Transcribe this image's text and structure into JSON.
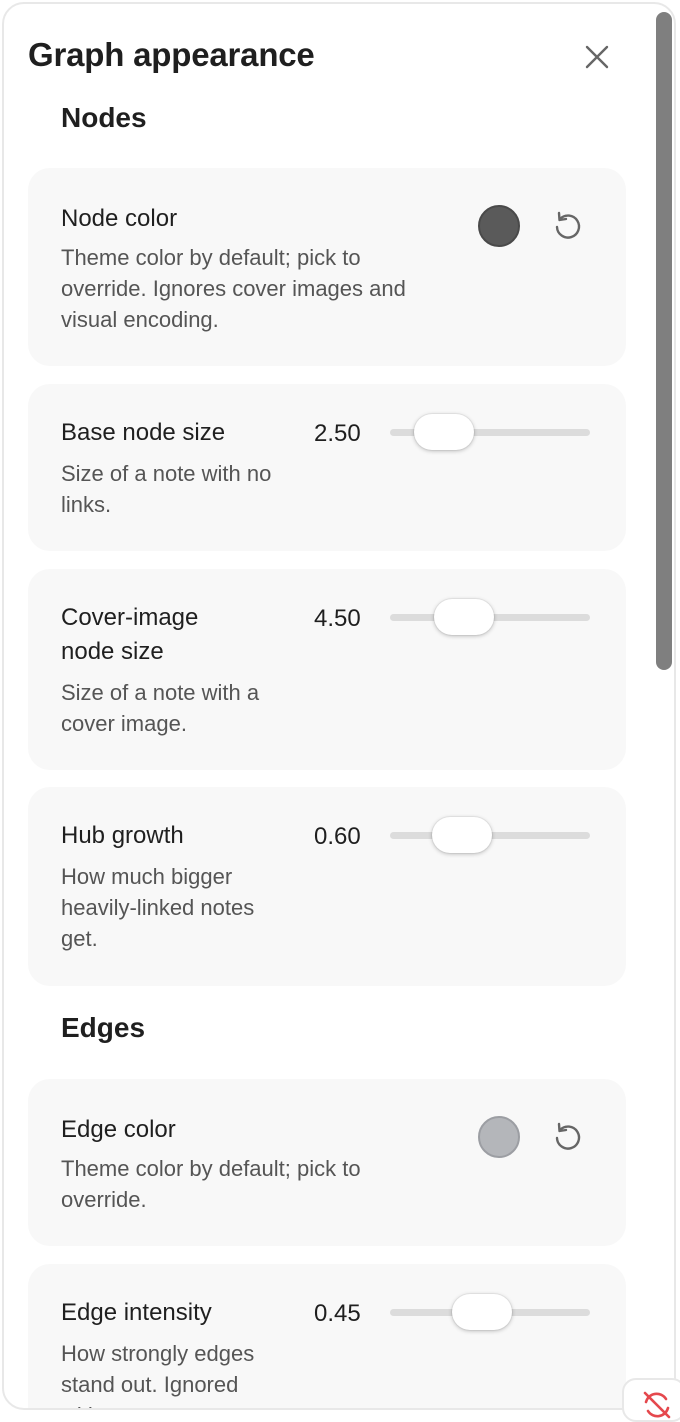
{
  "dialog": {
    "title": "Graph appearance",
    "close_icon": "close-icon"
  },
  "sections": {
    "nodes_title": "Nodes",
    "edges_title": "Edges"
  },
  "node_color": {
    "label": "Node color",
    "description": "Theme color by default; pick to override. Ignores cover images and visual encoding.",
    "swatch_color": "#5a5a5a",
    "reset_icon": "reset-icon"
  },
  "base_node_size": {
    "label": "Base node size",
    "description": "Size of a note with no links.",
    "value": "2.50"
  },
  "cover_image_node_size": {
    "label": "Cover-image node size",
    "description": "Size of a note with a cover image.",
    "value": "4.50"
  },
  "hub_growth": {
    "label": "Hub growth",
    "description": "How much bigger heavily-linked notes get.",
    "value": "0.60"
  },
  "edge_color": {
    "label": "Edge color",
    "description": "Theme color by default; pick to override.",
    "swatch_color": "#b4b6ba",
    "reset_icon": "reset-icon"
  },
  "edge_intensity": {
    "label": "Edge intensity",
    "description": "How strongly edges stand out. Ignored with a",
    "value": "0.45"
  },
  "floating_button": {
    "icon": "sync-off-icon",
    "accent": "#e5484d"
  }
}
